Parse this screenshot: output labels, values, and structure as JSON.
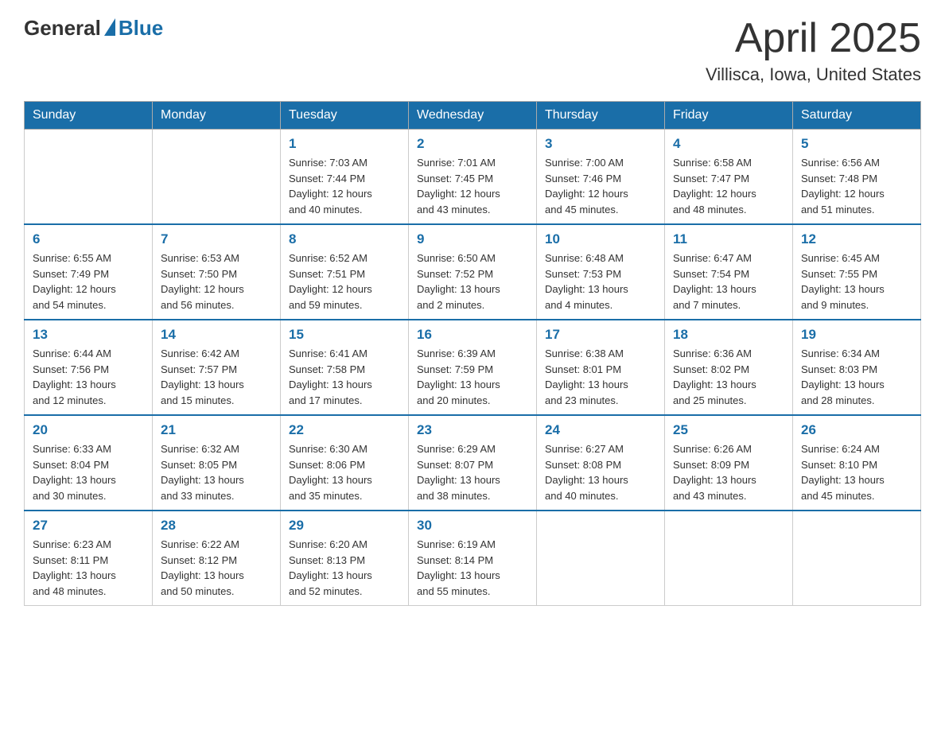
{
  "header": {
    "logo_general": "General",
    "logo_blue": "Blue",
    "title": "April 2025",
    "subtitle": "Villisca, Iowa, United States"
  },
  "weekdays": [
    "Sunday",
    "Monday",
    "Tuesday",
    "Wednesday",
    "Thursday",
    "Friday",
    "Saturday"
  ],
  "weeks": [
    [
      {
        "day": "",
        "info": ""
      },
      {
        "day": "",
        "info": ""
      },
      {
        "day": "1",
        "info": "Sunrise: 7:03 AM\nSunset: 7:44 PM\nDaylight: 12 hours\nand 40 minutes."
      },
      {
        "day": "2",
        "info": "Sunrise: 7:01 AM\nSunset: 7:45 PM\nDaylight: 12 hours\nand 43 minutes."
      },
      {
        "day": "3",
        "info": "Sunrise: 7:00 AM\nSunset: 7:46 PM\nDaylight: 12 hours\nand 45 minutes."
      },
      {
        "day": "4",
        "info": "Sunrise: 6:58 AM\nSunset: 7:47 PM\nDaylight: 12 hours\nand 48 minutes."
      },
      {
        "day": "5",
        "info": "Sunrise: 6:56 AM\nSunset: 7:48 PM\nDaylight: 12 hours\nand 51 minutes."
      }
    ],
    [
      {
        "day": "6",
        "info": "Sunrise: 6:55 AM\nSunset: 7:49 PM\nDaylight: 12 hours\nand 54 minutes."
      },
      {
        "day": "7",
        "info": "Sunrise: 6:53 AM\nSunset: 7:50 PM\nDaylight: 12 hours\nand 56 minutes."
      },
      {
        "day": "8",
        "info": "Sunrise: 6:52 AM\nSunset: 7:51 PM\nDaylight: 12 hours\nand 59 minutes."
      },
      {
        "day": "9",
        "info": "Sunrise: 6:50 AM\nSunset: 7:52 PM\nDaylight: 13 hours\nand 2 minutes."
      },
      {
        "day": "10",
        "info": "Sunrise: 6:48 AM\nSunset: 7:53 PM\nDaylight: 13 hours\nand 4 minutes."
      },
      {
        "day": "11",
        "info": "Sunrise: 6:47 AM\nSunset: 7:54 PM\nDaylight: 13 hours\nand 7 minutes."
      },
      {
        "day": "12",
        "info": "Sunrise: 6:45 AM\nSunset: 7:55 PM\nDaylight: 13 hours\nand 9 minutes."
      }
    ],
    [
      {
        "day": "13",
        "info": "Sunrise: 6:44 AM\nSunset: 7:56 PM\nDaylight: 13 hours\nand 12 minutes."
      },
      {
        "day": "14",
        "info": "Sunrise: 6:42 AM\nSunset: 7:57 PM\nDaylight: 13 hours\nand 15 minutes."
      },
      {
        "day": "15",
        "info": "Sunrise: 6:41 AM\nSunset: 7:58 PM\nDaylight: 13 hours\nand 17 minutes."
      },
      {
        "day": "16",
        "info": "Sunrise: 6:39 AM\nSunset: 7:59 PM\nDaylight: 13 hours\nand 20 minutes."
      },
      {
        "day": "17",
        "info": "Sunrise: 6:38 AM\nSunset: 8:01 PM\nDaylight: 13 hours\nand 23 minutes."
      },
      {
        "day": "18",
        "info": "Sunrise: 6:36 AM\nSunset: 8:02 PM\nDaylight: 13 hours\nand 25 minutes."
      },
      {
        "day": "19",
        "info": "Sunrise: 6:34 AM\nSunset: 8:03 PM\nDaylight: 13 hours\nand 28 minutes."
      }
    ],
    [
      {
        "day": "20",
        "info": "Sunrise: 6:33 AM\nSunset: 8:04 PM\nDaylight: 13 hours\nand 30 minutes."
      },
      {
        "day": "21",
        "info": "Sunrise: 6:32 AM\nSunset: 8:05 PM\nDaylight: 13 hours\nand 33 minutes."
      },
      {
        "day": "22",
        "info": "Sunrise: 6:30 AM\nSunset: 8:06 PM\nDaylight: 13 hours\nand 35 minutes."
      },
      {
        "day": "23",
        "info": "Sunrise: 6:29 AM\nSunset: 8:07 PM\nDaylight: 13 hours\nand 38 minutes."
      },
      {
        "day": "24",
        "info": "Sunrise: 6:27 AM\nSunset: 8:08 PM\nDaylight: 13 hours\nand 40 minutes."
      },
      {
        "day": "25",
        "info": "Sunrise: 6:26 AM\nSunset: 8:09 PM\nDaylight: 13 hours\nand 43 minutes."
      },
      {
        "day": "26",
        "info": "Sunrise: 6:24 AM\nSunset: 8:10 PM\nDaylight: 13 hours\nand 45 minutes."
      }
    ],
    [
      {
        "day": "27",
        "info": "Sunrise: 6:23 AM\nSunset: 8:11 PM\nDaylight: 13 hours\nand 48 minutes."
      },
      {
        "day": "28",
        "info": "Sunrise: 6:22 AM\nSunset: 8:12 PM\nDaylight: 13 hours\nand 50 minutes."
      },
      {
        "day": "29",
        "info": "Sunrise: 6:20 AM\nSunset: 8:13 PM\nDaylight: 13 hours\nand 52 minutes."
      },
      {
        "day": "30",
        "info": "Sunrise: 6:19 AM\nSunset: 8:14 PM\nDaylight: 13 hours\nand 55 minutes."
      },
      {
        "day": "",
        "info": ""
      },
      {
        "day": "",
        "info": ""
      },
      {
        "day": "",
        "info": ""
      }
    ]
  ]
}
